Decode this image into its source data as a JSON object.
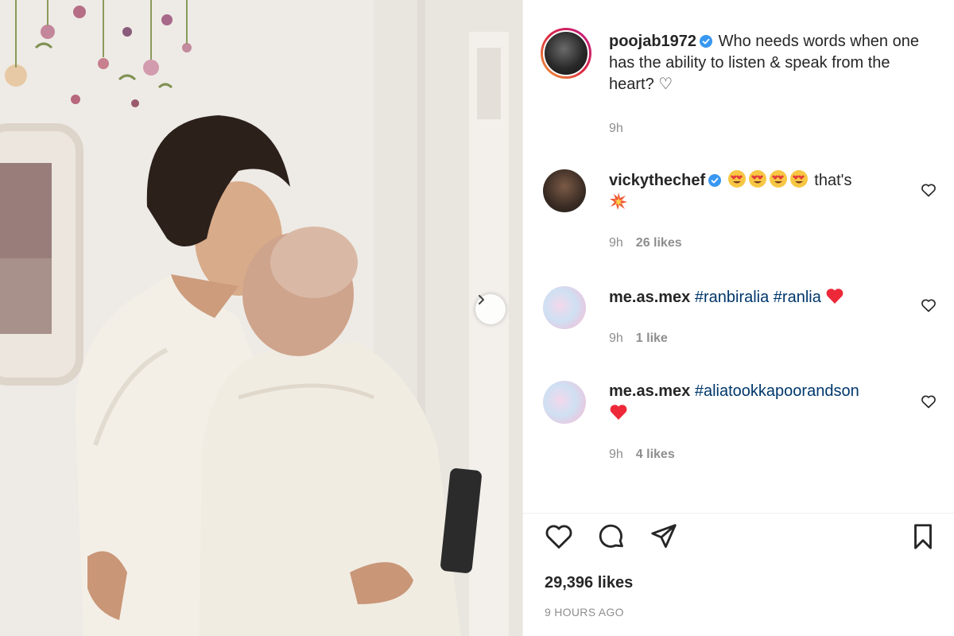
{
  "post": {
    "author": "poojab1972",
    "caption": "Who needs words when one has the ability to listen & speak from the heart? ♡",
    "time": "9h"
  },
  "comments": [
    {
      "user": "vickythechef",
      "text_after_emoji": "that's",
      "time": "9h",
      "likes": "26 likes"
    },
    {
      "user": "me.as.mex",
      "tags": "#ranbiralia #ranlia",
      "time": "9h",
      "likes": "1 like"
    },
    {
      "user": "me.as.mex",
      "tags": "#aliatookkapoorandson",
      "time": "9h",
      "likes": "4 likes"
    }
  ],
  "footer": {
    "likes": "29,396 likes",
    "posted": "9 HOURS AGO"
  },
  "colors": {
    "verified": "#3897f0",
    "hashtag": "#00376b",
    "muted": "#8e8e8e",
    "heart_red": "#ed4956"
  },
  "icons": [
    "verified-badge-icon",
    "heart-icon",
    "comment-icon",
    "share-icon",
    "bookmark-icon",
    "chevron-right-icon"
  ]
}
